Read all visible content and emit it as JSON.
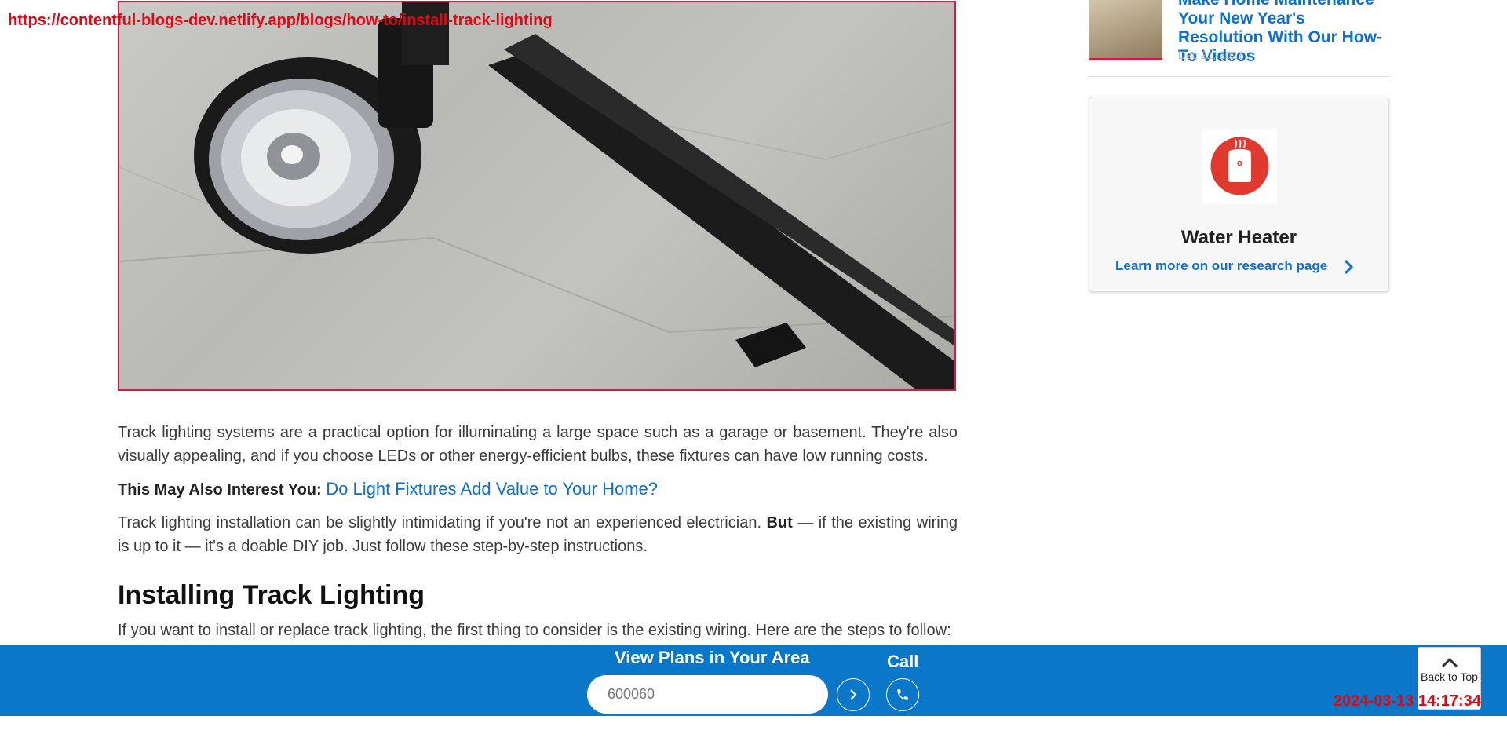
{
  "overlay": {
    "url": "https://contentful-blogs-dev.netlify.app/blogs/how-to/install-track-lighting",
    "timestamp": "2024-03-13 14:17:34"
  },
  "hero": {
    "alt": "Track lighting fixture on ceiling"
  },
  "article": {
    "p1": "Track lighting systems are a practical option for illuminating a large space such as a garage or basement. They're also visually appealing, and if you choose LEDs or other energy-efficient bulbs, these fixtures can have low running costs.",
    "interest_label": "This May Also Interest You:",
    "interest_link": "Do Light Fixtures Add Value to Your Home?",
    "p2_start": "Track lighting installation can be slightly intimidating if you're not an experienced electrician.",
    "p2_bold": "But",
    "p2_end": "— if the existing wiring is up to it — it's a doable DIY job. Just follow these step-by-step instructions.",
    "heading": "Installing Track Lighting",
    "p3": "If you want to install or replace track lighting, the first thing to consider is the existing wiring. Here are the steps to follow:"
  },
  "sidebar": {
    "post_title": "Make Home Maintenance Your New Year's Resolution With Our How-To Videos",
    "post_date": "Dec 21, 2021",
    "card_title": "Water Heater",
    "card_link": "Learn more on our research page"
  },
  "bottom_bar": {
    "label": "View Plans in Your Area",
    "zip_value": "600060",
    "call_label": "Call"
  },
  "back_to_top": {
    "label": "Back to Top"
  },
  "colors": {
    "accent": "#0a77c9",
    "link": "#0a6fd6",
    "brand_red": "#e03a2f"
  }
}
